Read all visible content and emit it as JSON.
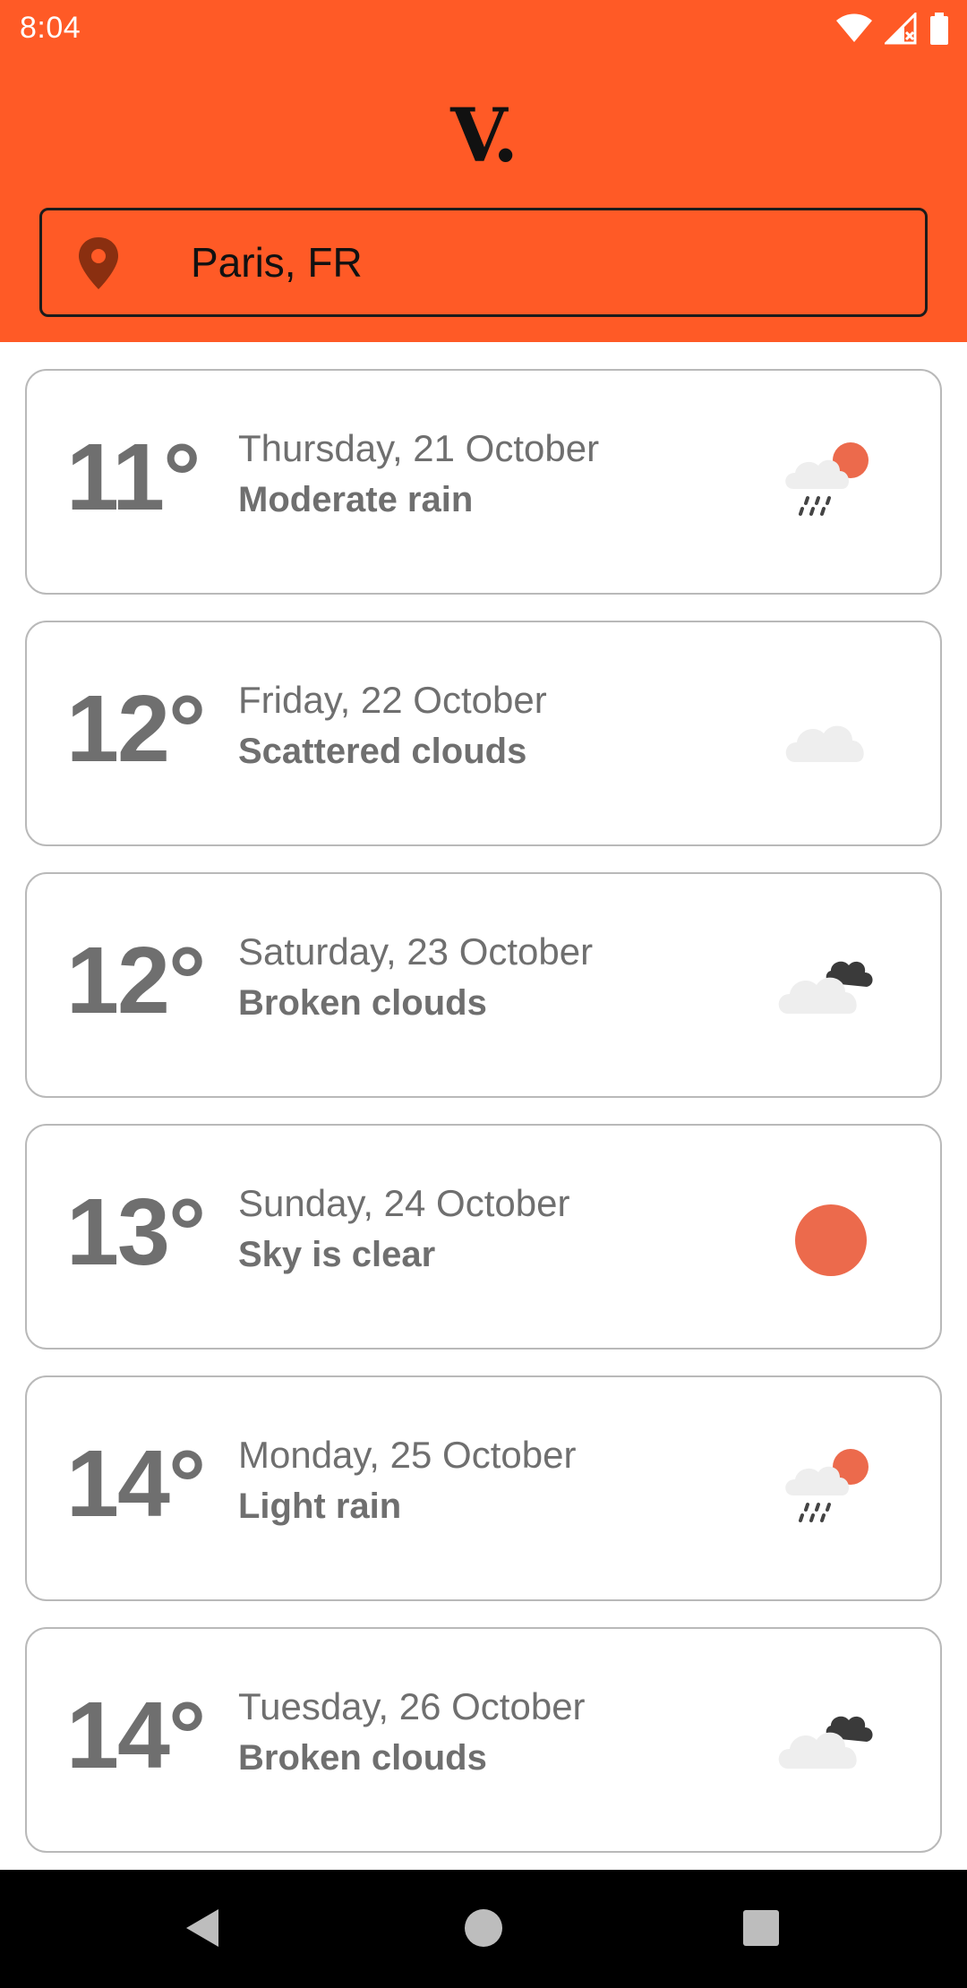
{
  "status_bar": {
    "time": "8:04",
    "icons": [
      "wifi-icon",
      "cell-signal-icon",
      "battery-icon"
    ]
  },
  "header": {
    "logo_text": "V.",
    "background_color": "#ff5a26"
  },
  "search": {
    "value": "Paris, FR",
    "icon": "location-pin-icon"
  },
  "forecast": [
    {
      "temp": "11°",
      "date": "Thursday, 21 October",
      "desc": "Moderate rain",
      "icon": "rain-sun-icon"
    },
    {
      "temp": "12°",
      "date": "Friday, 22 October",
      "desc": "Scattered clouds",
      "icon": "cloud-icon"
    },
    {
      "temp": "12°",
      "date": "Saturday, 23 October",
      "desc": "Broken clouds",
      "icon": "broken-clouds-icon"
    },
    {
      "temp": "13°",
      "date": "Sunday, 24 October",
      "desc": "Sky is clear",
      "icon": "sun-icon"
    },
    {
      "temp": "14°",
      "date": "Monday, 25 October",
      "desc": "Light rain",
      "icon": "rain-sun-icon"
    },
    {
      "temp": "14°",
      "date": "Tuesday, 26 October",
      "desc": "Broken clouds",
      "icon": "broken-clouds-icon"
    }
  ],
  "colors": {
    "accent": "#ff5a26",
    "sun": "#ec6a4c",
    "text_muted": "#6f6f6f",
    "card_border": "#b9b9b9"
  },
  "nav_bar": {
    "buttons": [
      "back-icon",
      "home-icon",
      "recents-icon"
    ]
  }
}
